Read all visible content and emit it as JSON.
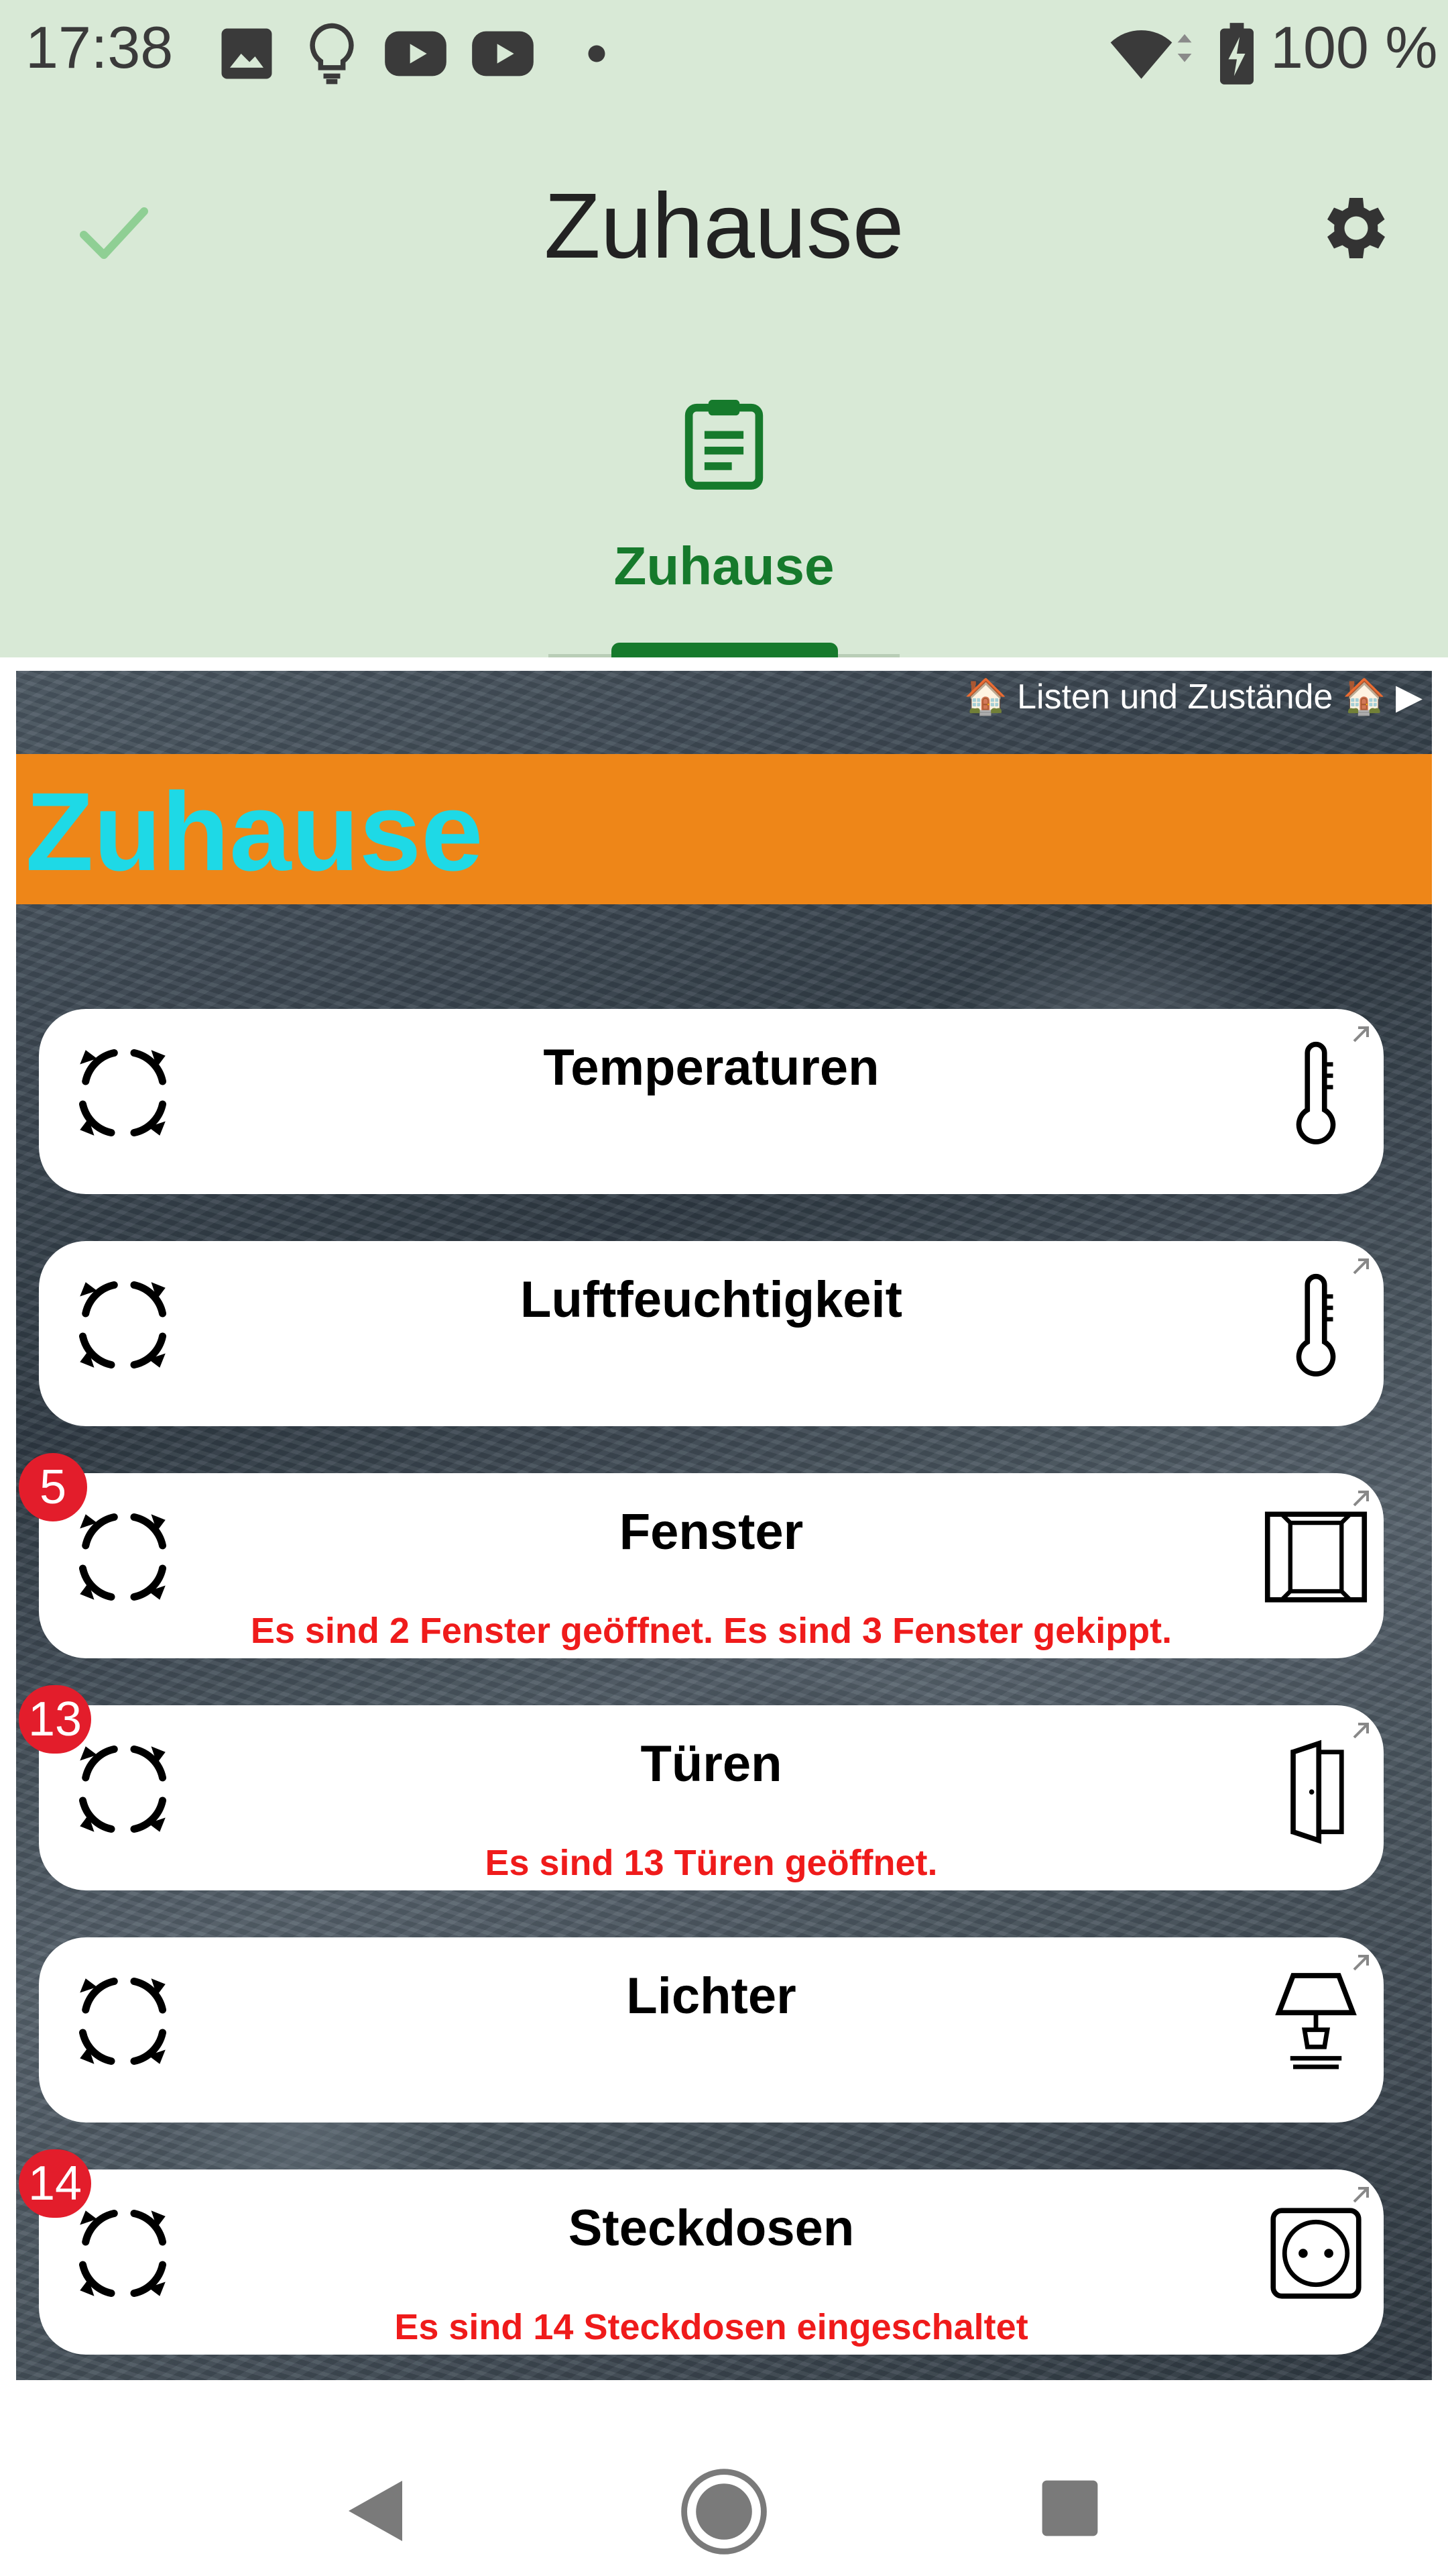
{
  "status_bar": {
    "time": "17:38",
    "left_icons": [
      "image-icon",
      "lightbulb-icon",
      "youtube-icon",
      "youtube-icon",
      "dot-icon"
    ],
    "right_icons": [
      "wifi-icon",
      "battery-charging-icon"
    ],
    "battery": "100 %"
  },
  "app_bar": {
    "title": "Zuhause",
    "left_icon": "check-icon",
    "right_icon": "gear-icon"
  },
  "tabs": [
    {
      "label": "Zuhause",
      "icon": "clipboard-icon",
      "selected": true
    }
  ],
  "webview": {
    "breadcrumb": "🏠 Listen und Zustände 🏠 ▶",
    "heading": "Zuhause",
    "cards": [
      {
        "title": "Temperaturen",
        "status": "",
        "badge": "",
        "icon": "thermometer-icon"
      },
      {
        "title": "Luftfeuchtigkeit",
        "status": "",
        "badge": "",
        "icon": "thermometer-icon"
      },
      {
        "title": "Fenster",
        "status": "Es sind 2 Fenster geöffnet. Es sind 3 Fenster gekippt.",
        "badge": "5",
        "icon": "window-icon"
      },
      {
        "title": "Türen",
        "status": "Es sind 13 Türen geöffnet.",
        "badge": "13",
        "icon": "door-icon"
      },
      {
        "title": "Lichter",
        "status": "",
        "badge": "",
        "icon": "lamp-icon"
      },
      {
        "title": "Steckdosen",
        "status": "Es sind 14 Steckdosen eingeschaltet",
        "badge": "14",
        "icon": "socket-icon"
      }
    ]
  },
  "nav_bar": {
    "icons": [
      "back-icon",
      "home-icon",
      "recents-icon"
    ]
  },
  "colors": {
    "app_bar_bg": "#d8e9d6",
    "accent_green": "#167a2c",
    "banner_orange": "#ee8618",
    "heading_cyan": "#1ed9e6",
    "status_red": "#ef1b1b",
    "badge_red": "#e31d2b"
  }
}
